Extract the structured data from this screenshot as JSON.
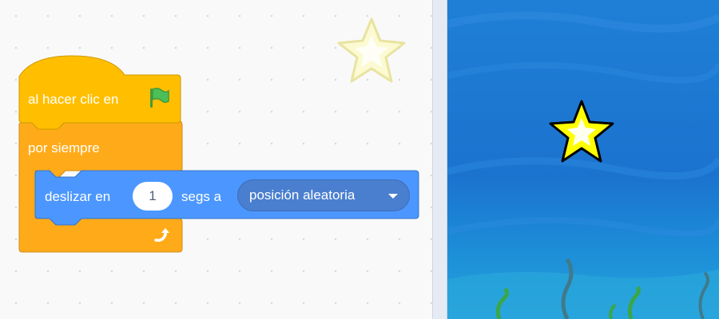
{
  "scripts": {
    "event_block": {
      "label": "al hacer clic en",
      "icon": "green-flag-icon",
      "color": "#ffbf00"
    },
    "forever_block": {
      "label": "por siempre",
      "color": "#ffab19",
      "loop_icon": "loop-arrow-icon"
    },
    "glide_block": {
      "prefix": "deslizar en",
      "seconds": "1",
      "middle": "segs a",
      "destination": "posición aleatoria",
      "color": "#4c97ff"
    }
  },
  "stage": {
    "backdrop": "underwater",
    "sprite": "star"
  }
}
